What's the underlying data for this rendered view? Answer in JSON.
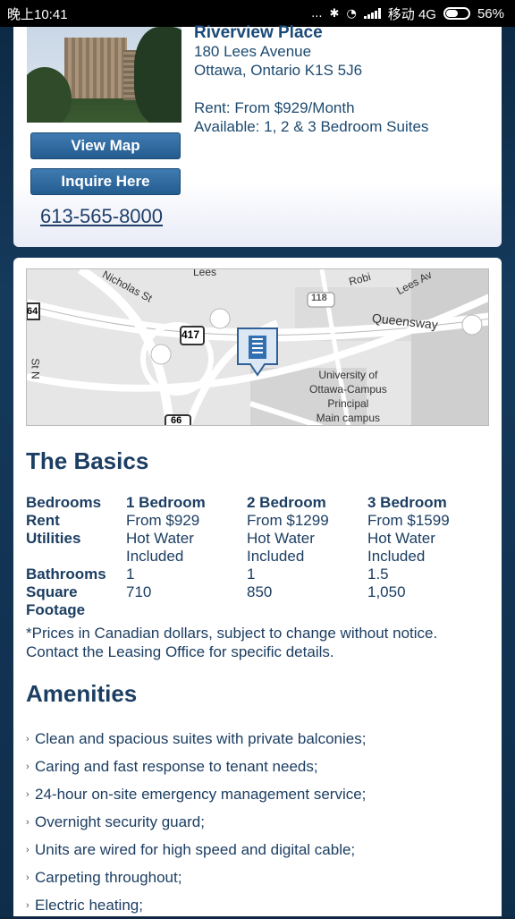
{
  "status": {
    "time": "晚上10:41",
    "dots": "...",
    "network": "移动 4G",
    "battery": "56%",
    "battery_level": 0.56
  },
  "listing": {
    "name": "Riverview Place",
    "address1": "180 Lees Avenue",
    "address2": "Ottawa, Ontario K1S 5J6",
    "rent": "Rent: From $929/Month",
    "available": "Available: 1, 2 & 3 Bedroom Suites",
    "view_map": "View Map",
    "inquire": "Inquire Here",
    "phone": "613-565-8000"
  },
  "map": {
    "labels": {
      "nicholas": "Nicholas St",
      "lees1": "Lees",
      "robi": "Robi",
      "lees2": "Lees Av",
      "hwy118": "118",
      "queensway": "Queensway",
      "hwy417": "417",
      "hwy66": "66",
      "stn": "St N",
      "n64": "64",
      "uni1": "University of",
      "uni2": "Ottawa-Campus",
      "uni3": "Principal",
      "uni4": "Main campus"
    }
  },
  "basics": {
    "title": "The Basics",
    "headers": [
      "Bedrooms",
      "1 Bedroom",
      "2 Bedroom",
      "3 Bedroom"
    ],
    "rent": [
      "Rent",
      "From $929",
      "From $1299",
      "From $1599"
    ],
    "utilities": [
      "Utilities",
      "Hot Water",
      "Hot Water",
      "Hot Water"
    ],
    "utilities2": [
      "",
      "Included",
      "Included",
      "Included"
    ],
    "bathrooms": [
      "Bathrooms",
      "1",
      "1",
      "1.5"
    ],
    "square": [
      "Square",
      "710",
      "850",
      "1,050"
    ],
    "footage": "Footage",
    "note": "*Prices in Canadian dollars, subject to change without notice. Contact the Leasing Office for specific details."
  },
  "amenities": {
    "title": "Amenities",
    "items": [
      "Clean and spacious suites with private balconies;",
      "Caring and fast response to tenant needs;",
      "24-hour on-site emergency management service;",
      "Overnight security guard;",
      "Units are wired for high speed and digital cable;",
      "Carpeting throughout;",
      "Electric heating;"
    ]
  }
}
